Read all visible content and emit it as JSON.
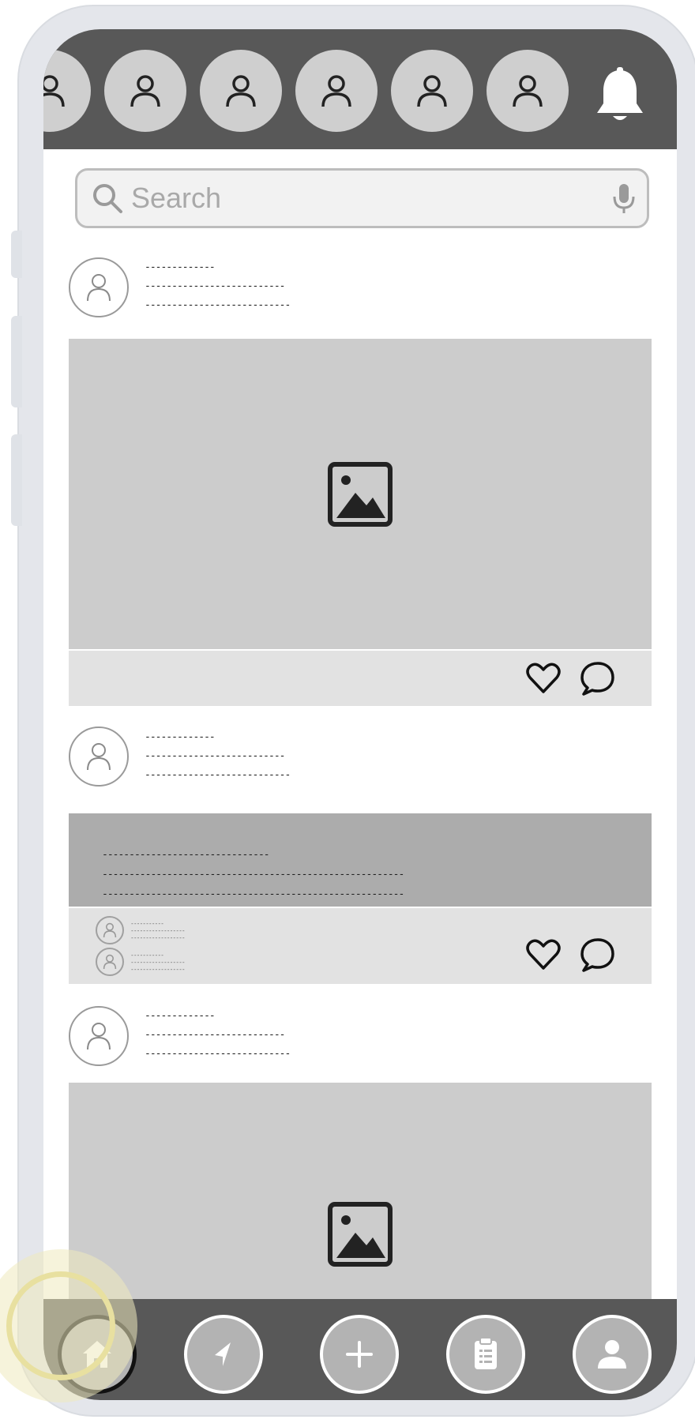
{
  "stories": {
    "items": [
      "story-1",
      "story-2",
      "story-3",
      "story-4",
      "story-5",
      "story-6"
    ],
    "notification_icon": "bell-icon"
  },
  "search": {
    "placeholder": "Search"
  },
  "posts": [
    {
      "type": "image",
      "meta": [
        "-------------",
        "--------------------------",
        "---------------------------"
      ],
      "media_icon": "image-icon"
    },
    {
      "type": "text",
      "meta": [
        "-------------",
        "--------------------------",
        "---------------------------"
      ],
      "body": [
        "-------------------------------",
        "--------------------------------------------------------",
        "--------------------------------------------------------"
      ],
      "comments": [
        {
          "lines": [
            "-----------",
            "------------------",
            "------------------"
          ]
        },
        {
          "lines": [
            "-----------",
            "------------------",
            "------------------"
          ]
        }
      ]
    },
    {
      "type": "image",
      "meta": [
        "-------------",
        "--------------------------",
        "---------------------------"
      ],
      "media_icon": "image-icon"
    }
  ],
  "nav": {
    "items": [
      "home-icon",
      "explore-icon",
      "add-icon",
      "clipboard-icon",
      "profile-icon"
    ],
    "active": "home"
  },
  "colors": {
    "bars": "#585858",
    "media": "#cccccc",
    "highlight": "#e8e0a0"
  }
}
